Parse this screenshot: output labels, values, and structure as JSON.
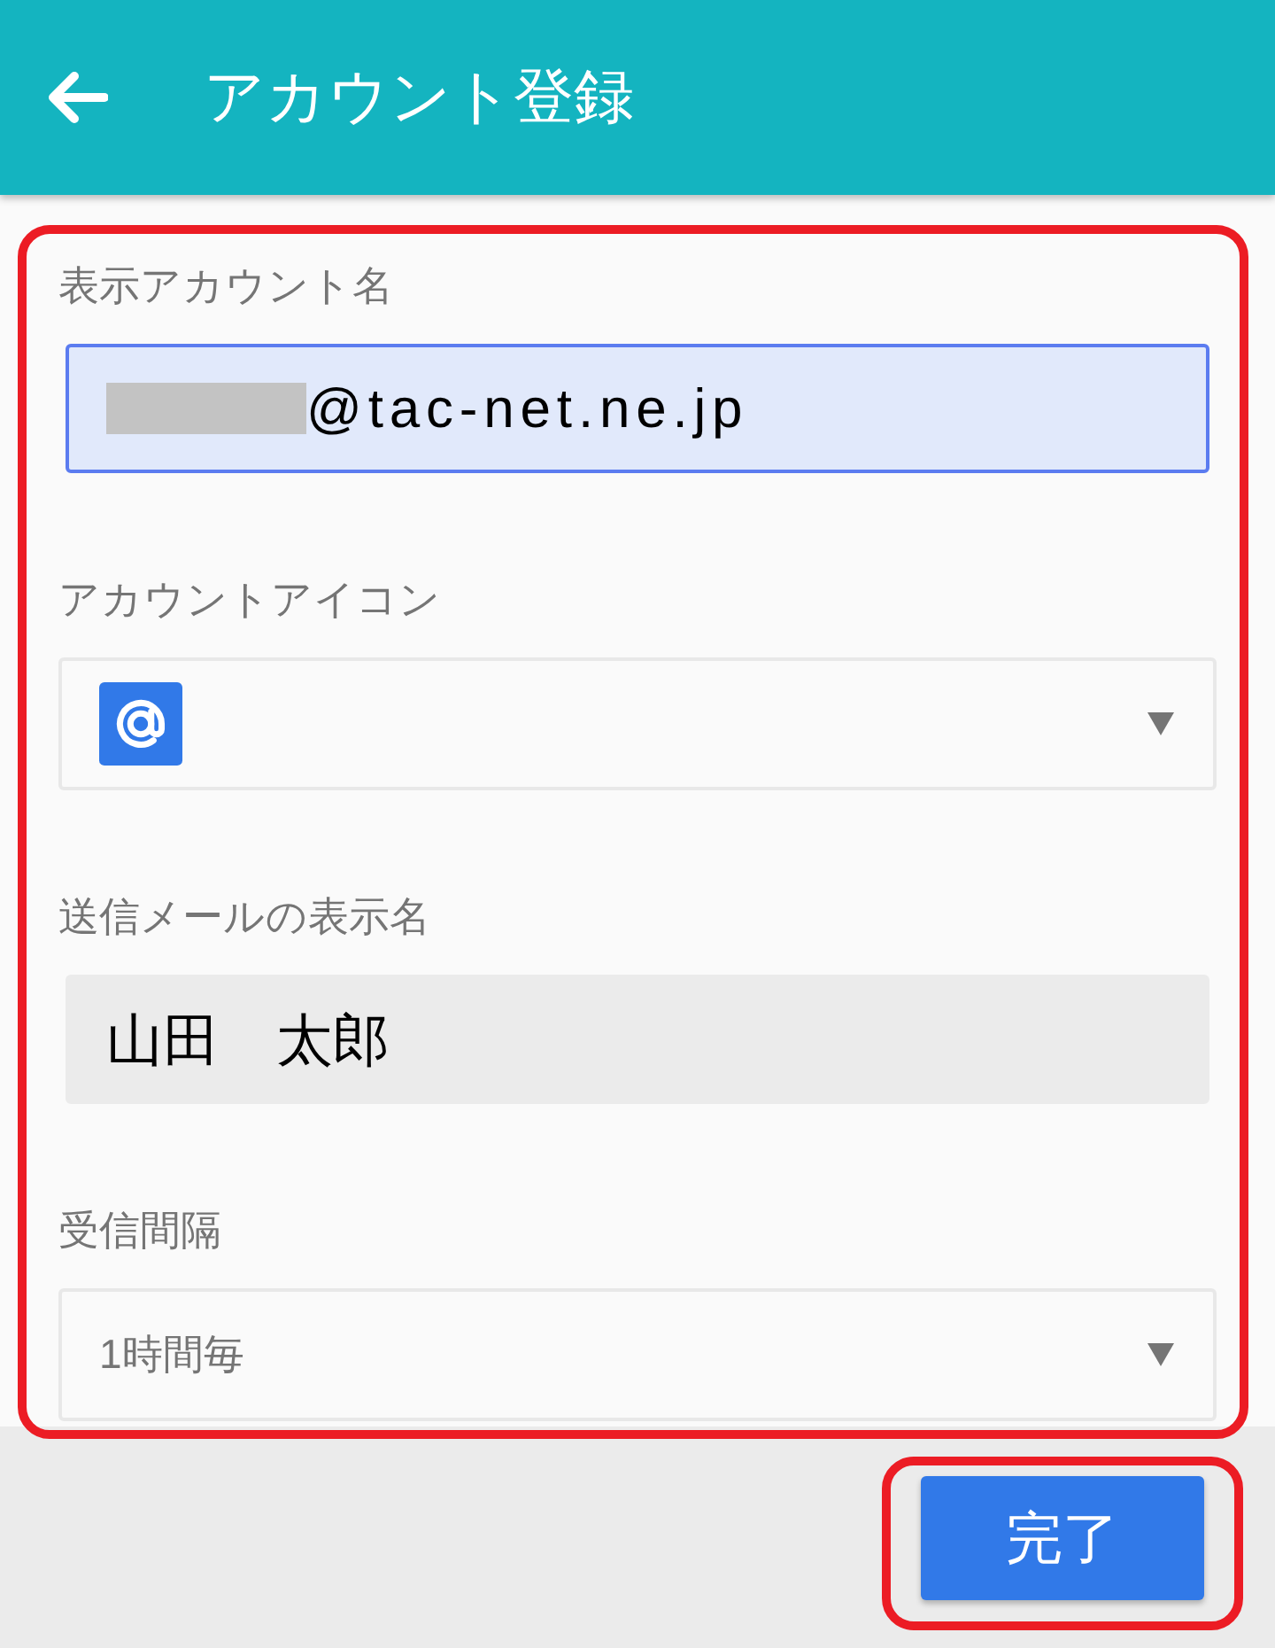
{
  "header": {
    "title": "アカウント登録"
  },
  "form": {
    "highlighted": true,
    "fields": [
      {
        "kind": "text",
        "label": "表示アカウント名",
        "value": "@tac-net.ne.jp",
        "focused": true,
        "redacted_prefix": true
      },
      {
        "kind": "icon_select",
        "label": "アカウントアイコン"
      },
      {
        "kind": "text",
        "label": "送信メールの表示名",
        "value": "山田　太郎",
        "focused": false,
        "redacted_prefix": false
      },
      {
        "kind": "select",
        "label": "受信間隔",
        "value": "1時間毎"
      }
    ]
  },
  "done_button": {
    "label": "完了",
    "highlighted": true
  }
}
